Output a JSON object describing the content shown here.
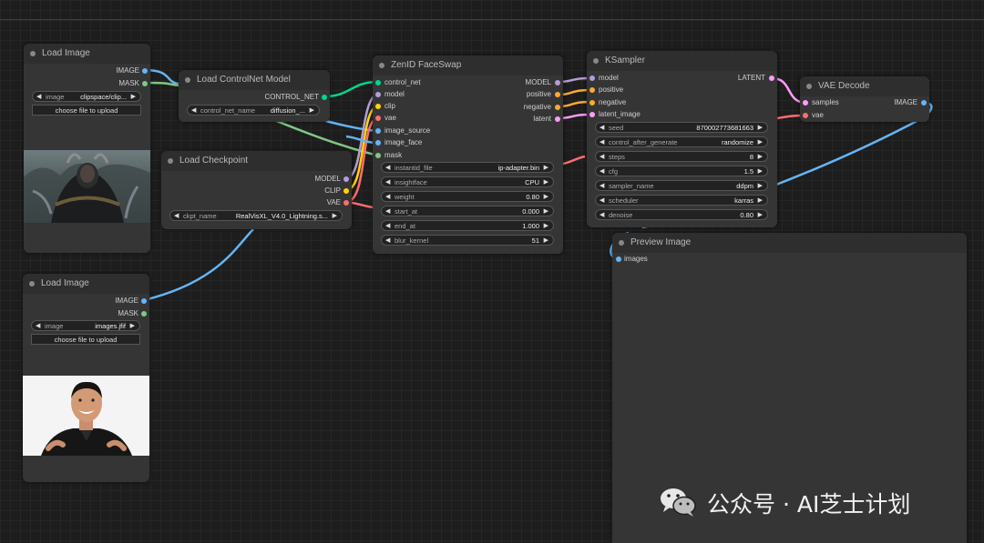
{
  "nodes": {
    "load_image_1": {
      "title": "Load Image",
      "outputs": [
        "IMAGE",
        "MASK"
      ],
      "image_widget": {
        "label": "image",
        "value": "clipspace/clip..."
      },
      "upload_button": "choose file to upload"
    },
    "load_controlnet": {
      "title": "Load ControlNet Model",
      "output": "CONTROL_NET",
      "widget": {
        "label": "control_net_name",
        "value": "diffusion_..."
      }
    },
    "load_checkpoint": {
      "title": "Load Checkpoint",
      "outputs": [
        "MODEL",
        "CLIP",
        "VAE"
      ],
      "widget": {
        "label": "ckpt_name",
        "value": "RealVisXL_V4.0_Lightning.s..."
      }
    },
    "load_image_2": {
      "title": "Load Image",
      "outputs": [
        "IMAGE",
        "MASK"
      ],
      "image_widget": {
        "label": "image",
        "value": "images.jfif"
      },
      "upload_button": "choose file to upload"
    },
    "zenid": {
      "title": "ZenID FaceSwap",
      "inputs": [
        "control_net",
        "model",
        "clip",
        "vae",
        "image_source",
        "image_face",
        "mask"
      ],
      "outputs": [
        "MODEL",
        "positive",
        "negative",
        "latent"
      ],
      "widgets": [
        {
          "label": "instantid_file",
          "value": "ip-adapter.bin"
        },
        {
          "label": "insightface",
          "value": "CPU"
        },
        {
          "label": "weight",
          "value": "0.80"
        },
        {
          "label": "start_at",
          "value": "0.000"
        },
        {
          "label": "end_at",
          "value": "1.000"
        },
        {
          "label": "blur_kernel",
          "value": "51"
        }
      ]
    },
    "ksampler": {
      "title": "KSampler",
      "inputs": [
        "model",
        "positive",
        "negative",
        "latent_image"
      ],
      "output": "LATENT",
      "widgets": [
        {
          "label": "seed",
          "value": "870002773681663"
        },
        {
          "label": "control_after_generate",
          "value": "randomize"
        },
        {
          "label": "steps",
          "value": "8"
        },
        {
          "label": "cfg",
          "value": "1.5"
        },
        {
          "label": "sampler_name",
          "value": "ddpm"
        },
        {
          "label": "scheduler",
          "value": "karras"
        },
        {
          "label": "denoise",
          "value": "0.80"
        }
      ]
    },
    "vae_decode": {
      "title": "VAE Decode",
      "inputs": [
        "samples",
        "vae"
      ],
      "output": "IMAGE"
    },
    "preview_image": {
      "title": "Preview Image",
      "input": "images"
    }
  },
  "colors": {
    "image": "#64b5f6",
    "mask": "#81c784",
    "control_net": "#00d78d",
    "model": "#b39ddb",
    "clip": "#ffd500",
    "vae": "#ff6e6e",
    "conditioning": "#ffa931",
    "latent": "#ff9cf9"
  },
  "watermark": "公众号 · AI芝士计划"
}
